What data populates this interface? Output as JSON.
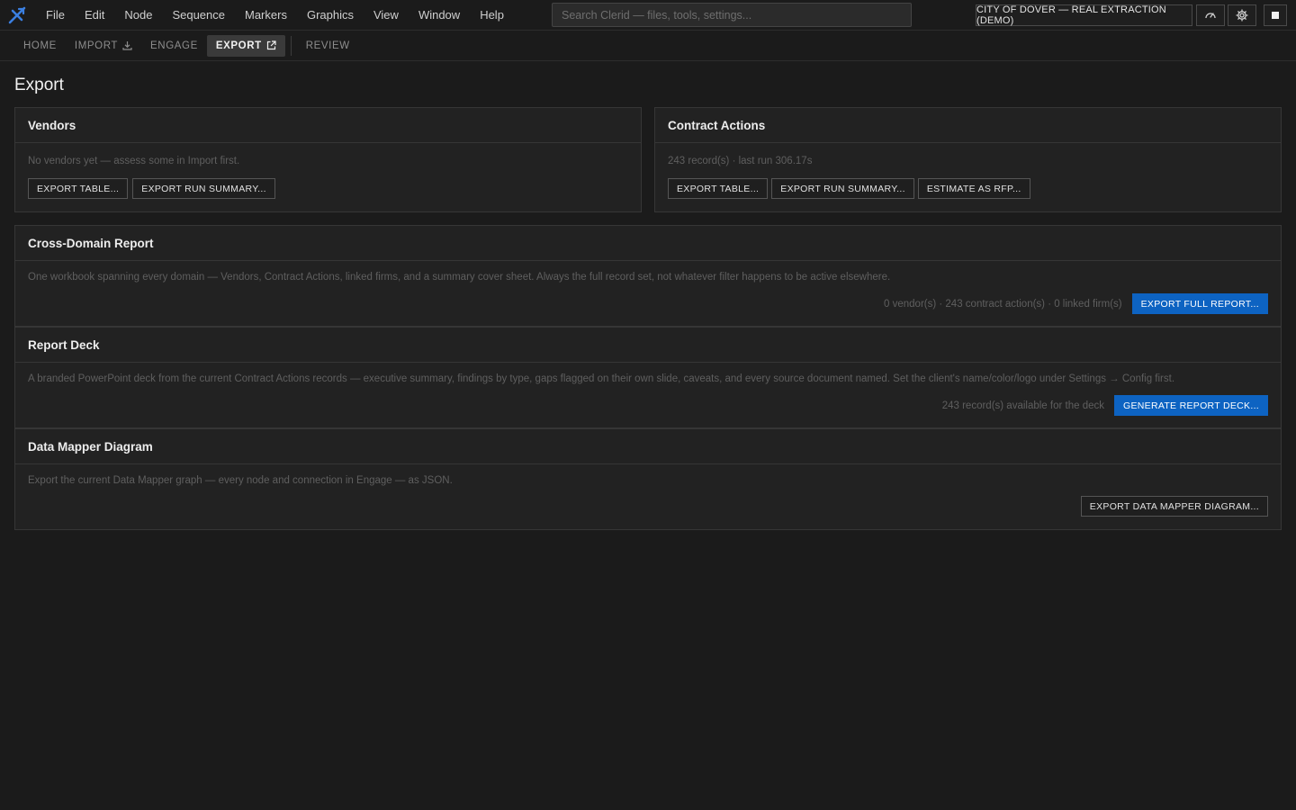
{
  "menubar": {
    "items": [
      "File",
      "Edit",
      "Node",
      "Sequence",
      "Markers",
      "Graphics",
      "View",
      "Window",
      "Help"
    ],
    "search_placeholder": "Search Clerid — files, tools, settings...",
    "project_name": "CITY OF DOVER — REAL EXTRACTION (DEMO)",
    "icons": [
      "gauge-icon",
      "gear-icon",
      "stop-icon"
    ]
  },
  "tabs": [
    {
      "label": "HOME",
      "active": false
    },
    {
      "label": "IMPORT",
      "active": false,
      "icon": "download-icon"
    },
    {
      "label": "ENGAGE",
      "active": false
    },
    {
      "label": "EXPORT",
      "active": true,
      "icon": "external-link-icon"
    },
    {
      "label": "REVIEW",
      "active": false
    }
  ],
  "page_title": "Export",
  "vendors": {
    "title": "Vendors",
    "status": "No vendors yet — assess some in Import first.",
    "btn_export_table": "EXPORT TABLE...",
    "btn_export_summary": "EXPORT RUN SUMMARY..."
  },
  "contract_actions": {
    "title": "Contract Actions",
    "status": "243 record(s) · last run 306.17s",
    "btn_export_table": "EXPORT TABLE...",
    "btn_export_summary": "EXPORT RUN SUMMARY...",
    "btn_estimate": "ESTIMATE AS RFP..."
  },
  "cross_domain": {
    "title": "Cross-Domain Report",
    "description": "One workbook spanning every domain — Vendors, Contract Actions, linked firms, and a summary cover sheet. Always the full record set, not whatever filter happens to be active elsewhere.",
    "counts": "0 vendor(s) · 243 contract action(s) · 0 linked firm(s)",
    "btn": "EXPORT FULL REPORT..."
  },
  "report_deck": {
    "title": "Report Deck",
    "description": "A branded PowerPoint deck from the current Contract Actions records — executive summary, findings by type, gaps flagged on their own slide, caveats, and every source document named. Set the client's name/color/logo under Settings → Config first.",
    "counts": "243 record(s) available for the deck",
    "btn": "GENERATE REPORT DECK..."
  },
  "data_mapper": {
    "title": "Data Mapper Diagram",
    "description": "Export the current Data Mapper graph — every node and connection in Engage — as JSON.",
    "btn": "EXPORT DATA MAPPER DIAGRAM..."
  },
  "colors": {
    "background": "#1b1b1b",
    "panel": "#222222",
    "accent": "#0d63c2",
    "logo": "#3b7fe0"
  }
}
